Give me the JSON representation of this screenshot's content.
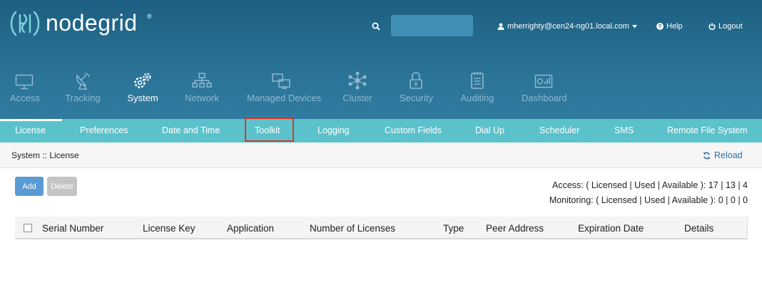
{
  "brand": {
    "name": "nodegrid",
    "reg": "®"
  },
  "header": {
    "search_placeholder": "",
    "user": "mherrighty@cen24-ng01.local.com",
    "help": "Help",
    "logout": "Logout"
  },
  "main_nav": [
    {
      "label": "Access",
      "icon": "monitor-icon"
    },
    {
      "label": "Tracking",
      "icon": "satellite-dish-icon"
    },
    {
      "label": "System",
      "icon": "gears-icon"
    },
    {
      "label": "Network",
      "icon": "network-icon"
    },
    {
      "label": "Managed Devices",
      "icon": "devices-icon"
    },
    {
      "label": "Cluster",
      "icon": "cluster-icon"
    },
    {
      "label": "Security",
      "icon": "lock-icon"
    },
    {
      "label": "Auditing",
      "icon": "notepad-icon"
    },
    {
      "label": "Dashboard",
      "icon": "dashboard-icon"
    }
  ],
  "sub_nav": [
    "License",
    "Preferences",
    "Date and Time",
    "Toolkit",
    "Logging",
    "Custom Fields",
    "Dial Up",
    "Scheduler",
    "SMS",
    "Remote File System"
  ],
  "breadcrumb": "System :: License",
  "reload": "Reload",
  "buttons": {
    "add": "Add",
    "delete": "Delete"
  },
  "stats": {
    "access": "Access: ( Licensed | Used | Available ): 17 | 13 | 4",
    "monitoring": "Monitoring: ( Licensed | Used | Available ): 0 | 0 | 0"
  },
  "table": {
    "columns": [
      "Serial Number",
      "License Key",
      "Application",
      "Number of Licenses",
      "Type",
      "Peer Address",
      "Expiration Date",
      "Details"
    ],
    "rows": []
  },
  "colors": {
    "header": "#2a7396",
    "subnav": "#5bc2cc",
    "accent": "#2a72a8",
    "highlight": "#d9372b"
  }
}
